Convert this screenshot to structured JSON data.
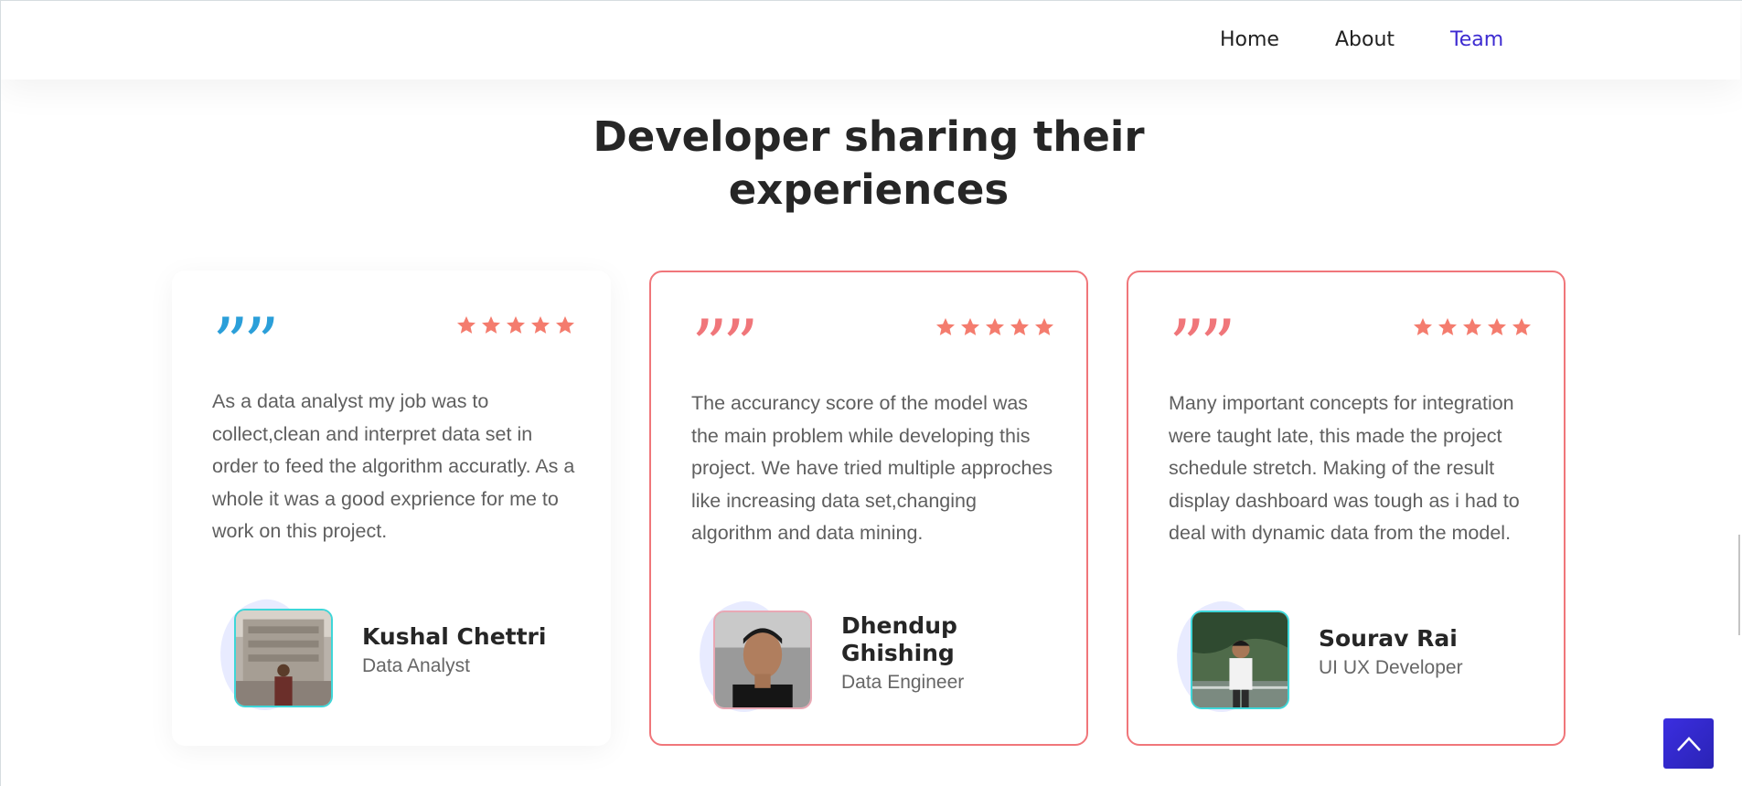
{
  "nav": {
    "items": [
      {
        "label": "Home",
        "active": false
      },
      {
        "label": "About",
        "active": false
      },
      {
        "label": "Team",
        "active": true
      }
    ],
    "active_color": "#3d2bd1"
  },
  "section": {
    "heading_bold": "Developer sharing",
    "heading_rest": " their",
    "heading_line2": "experiences"
  },
  "testimonials": [
    {
      "quote_color": "#2b9fd9",
      "rating": 5,
      "text": "As a data analyst my job was to collect,clean and interpret data set in order to feed the algorithm accuratly. As a whole it was a good exprience for me to work on this project.",
      "name": "Kushal Chettri",
      "role": "Data Analyst",
      "highlighted": false
    },
    {
      "quote_color": "#f0767a",
      "rating": 5,
      "text": "The accurancy score of the model was the main problem while developing this project. We have tried multiple approches like increasing data set,changing algorithm and data mining.",
      "name": "Dhendup Ghishing",
      "role": "Data Engineer",
      "highlighted": true
    },
    {
      "quote_color": "#f0767a",
      "rating": 5,
      "text": "Many important concepts for integration were taught late, this made the project schedule stretch. Making of the result display dashboard was tough as i had to deal with dynamic data from the model.",
      "name": "Sourav Rai",
      "role": "UI UX Developer",
      "highlighted": true
    }
  ],
  "colors": {
    "star": "#f47c6e",
    "highlight_border": "#f0767a",
    "scroll_button": "#3b2ee0"
  },
  "icons": {
    "quote": "quote-icon",
    "star": "star-icon",
    "scroll_top": "chevron-up-icon"
  }
}
